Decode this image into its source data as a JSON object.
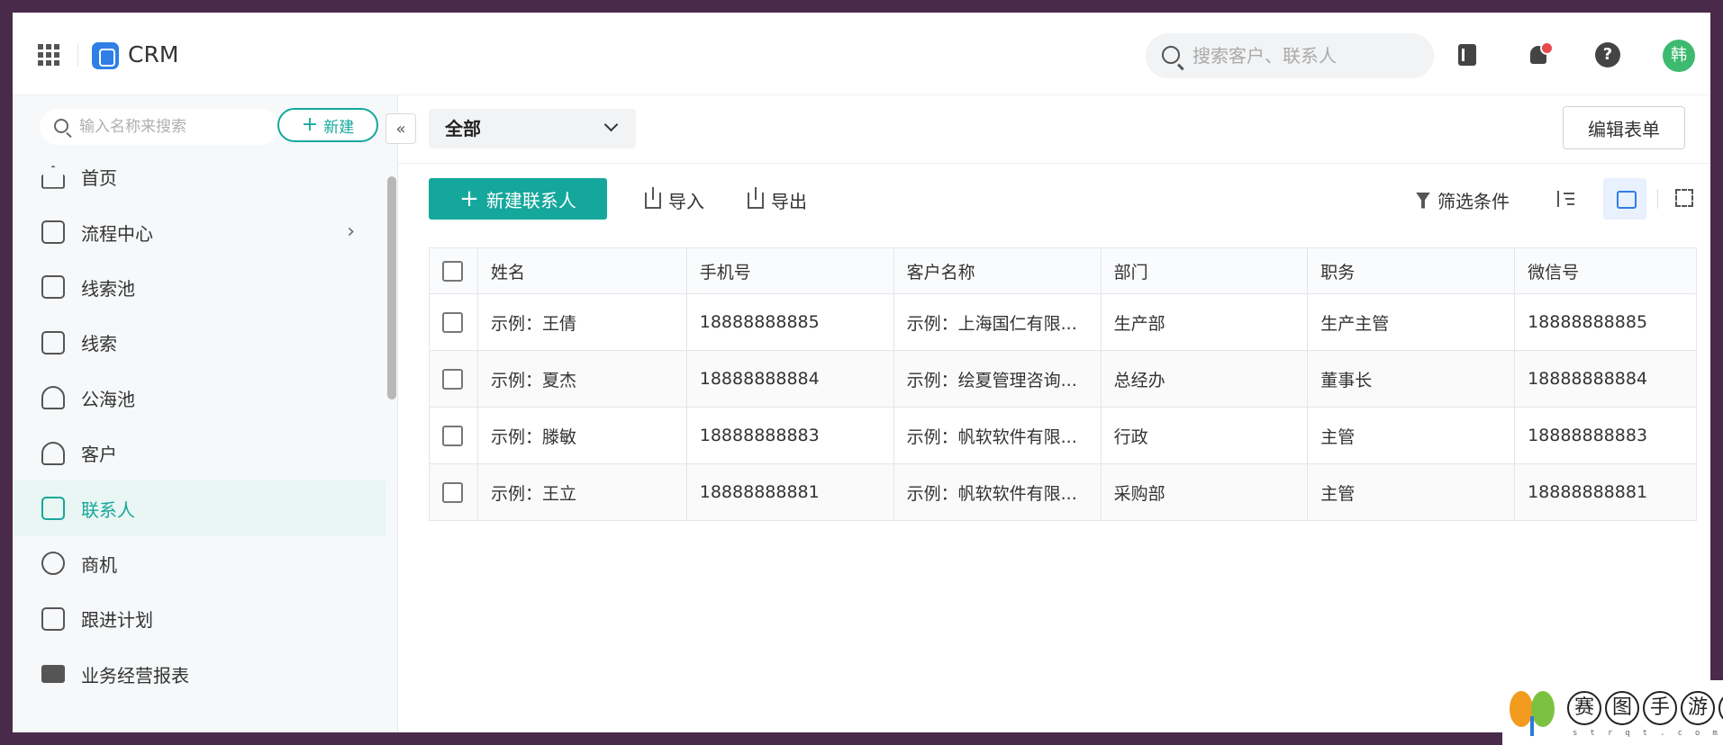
{
  "header": {
    "brand": "CRM",
    "search_placeholder": "搜索客户、联系人",
    "avatar_text": "韩"
  },
  "sidebar": {
    "search_placeholder": "输入名称来搜索",
    "new_label": "新建",
    "collapse_glyph": "«",
    "items": [
      {
        "label": "首页",
        "icon": "home-icon"
      },
      {
        "label": "流程中心",
        "icon": "org-chart-icon",
        "has_children": true
      },
      {
        "label": "线索池",
        "icon": "lead-pool-icon"
      },
      {
        "label": "线索",
        "icon": "route-icon"
      },
      {
        "label": "公海池",
        "icon": "public-pool-icon"
      },
      {
        "label": "客户",
        "icon": "customer-icon"
      },
      {
        "label": "联系人",
        "icon": "contacts-icon",
        "active": true
      },
      {
        "label": "商机",
        "icon": "opportunity-icon"
      },
      {
        "label": "跟进计划",
        "icon": "calendar-icon"
      },
      {
        "label": "业务经营报表",
        "icon": "folder-icon"
      }
    ]
  },
  "main": {
    "view_select": "全部",
    "edit_form_label": "编辑表单",
    "toolbar": {
      "new_contact": "新建联系人",
      "import": "导入",
      "export": "导出",
      "filter": "筛选条件"
    },
    "table": {
      "columns": [
        "姓名",
        "手机号",
        "客户名称",
        "部门",
        "职务",
        "微信号"
      ],
      "rows": [
        [
          "示例：王倩",
          "18888888885",
          "示例：上海国仁有限...",
          "生产部",
          "生产主管",
          "18888888885"
        ],
        [
          "示例：夏杰",
          "18888888884",
          "示例：绘夏管理咨询...",
          "总经办",
          "董事长",
          "18888888884"
        ],
        [
          "示例：滕敏",
          "18888888883",
          "示例：帆软软件有限...",
          "行政",
          "主管",
          "18888888883"
        ],
        [
          "示例：王立",
          "18888888881",
          "示例：帆软软件有限...",
          "采购部",
          "主管",
          "18888888881"
        ]
      ]
    }
  },
  "watermark": {
    "chars": [
      "赛",
      "图",
      "手",
      "游",
      "网"
    ],
    "sub": "strqt.com"
  },
  "colors": {
    "accent": "#16a79c",
    "active_bg": "#e9f6f3",
    "avatar": "#3dba6f",
    "logo": "#2f7fe6"
  }
}
